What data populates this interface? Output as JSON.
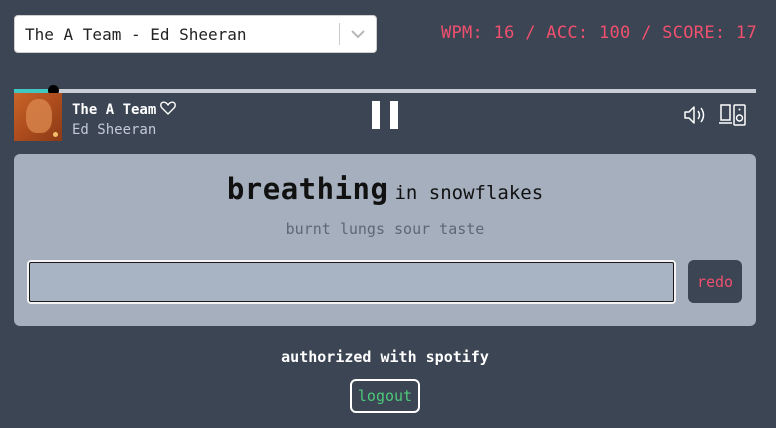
{
  "song_select": {
    "selected": "The A Team - Ed Sheeran",
    "dropdown_icon": "chevron-down-icon"
  },
  "stats": {
    "text": "WPM: 16 / ACC: 100 / SCORE: 17"
  },
  "player": {
    "progress_fraction": 0.053,
    "track_title": "The A Team",
    "artist": "Ed Sheeran",
    "like_icon": "heart-icon",
    "play_state_icon": "pause-icon",
    "volume_icon": "volume-icon",
    "device_icon": "devices-icon"
  },
  "typing": {
    "current_word": "breathing",
    "rest_of_line": "in snowflakes",
    "next_line": "burnt lungs sour taste",
    "input_value": "",
    "redo_label": "redo"
  },
  "footer": {
    "auth_text": "authorized with spotify",
    "logout_label": "logout"
  },
  "colors": {
    "background": "#3b4554",
    "stats": "#f0506e",
    "panel": "#a5afbd",
    "progress_fill": "#3fc7c0",
    "logout_text": "#4cc97a"
  }
}
